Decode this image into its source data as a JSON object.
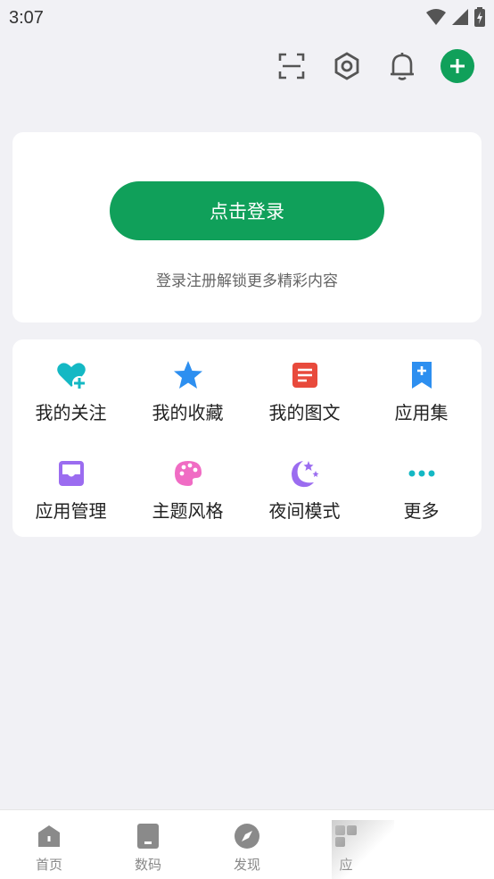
{
  "status_bar": {
    "time": "3:07"
  },
  "toolbar": {
    "icons": [
      "scan-icon",
      "settings-icon",
      "bell-icon",
      "add-icon"
    ]
  },
  "login": {
    "button_label": "点击登录",
    "hint": "登录注册解锁更多精彩内容"
  },
  "menu": {
    "items": [
      {
        "label": "我的关注",
        "icon": "heart-plus-icon",
        "color": "#14b8c4"
      },
      {
        "label": "我的收藏",
        "icon": "star-icon",
        "color": "#2d8ff0"
      },
      {
        "label": "我的图文",
        "icon": "document-icon",
        "color": "#e84a3c"
      },
      {
        "label": "应用集",
        "icon": "bookmark-plus-icon",
        "color": "#2d8ff0"
      },
      {
        "label": "应用管理",
        "icon": "inbox-icon",
        "color": "#9b6cf0"
      },
      {
        "label": "主题风格",
        "icon": "palette-icon",
        "color": "#f06cc4"
      },
      {
        "label": "夜间模式",
        "icon": "moon-stars-icon",
        "color": "#9b6cf0"
      },
      {
        "label": "更多",
        "icon": "more-dots-icon",
        "color": "#14b8c4"
      }
    ]
  },
  "bottom_nav": {
    "items": [
      {
        "label": "首页",
        "icon": "home-icon"
      },
      {
        "label": "数码",
        "icon": "device-icon"
      },
      {
        "label": "发现",
        "icon": "compass-icon"
      },
      {
        "label": "应",
        "icon": "apps-icon"
      }
    ]
  },
  "colors": {
    "accent": "#10a05a",
    "background": "#f1f1f5",
    "icon_gray": "#555555",
    "nav_gray": "#8a8a8a"
  }
}
